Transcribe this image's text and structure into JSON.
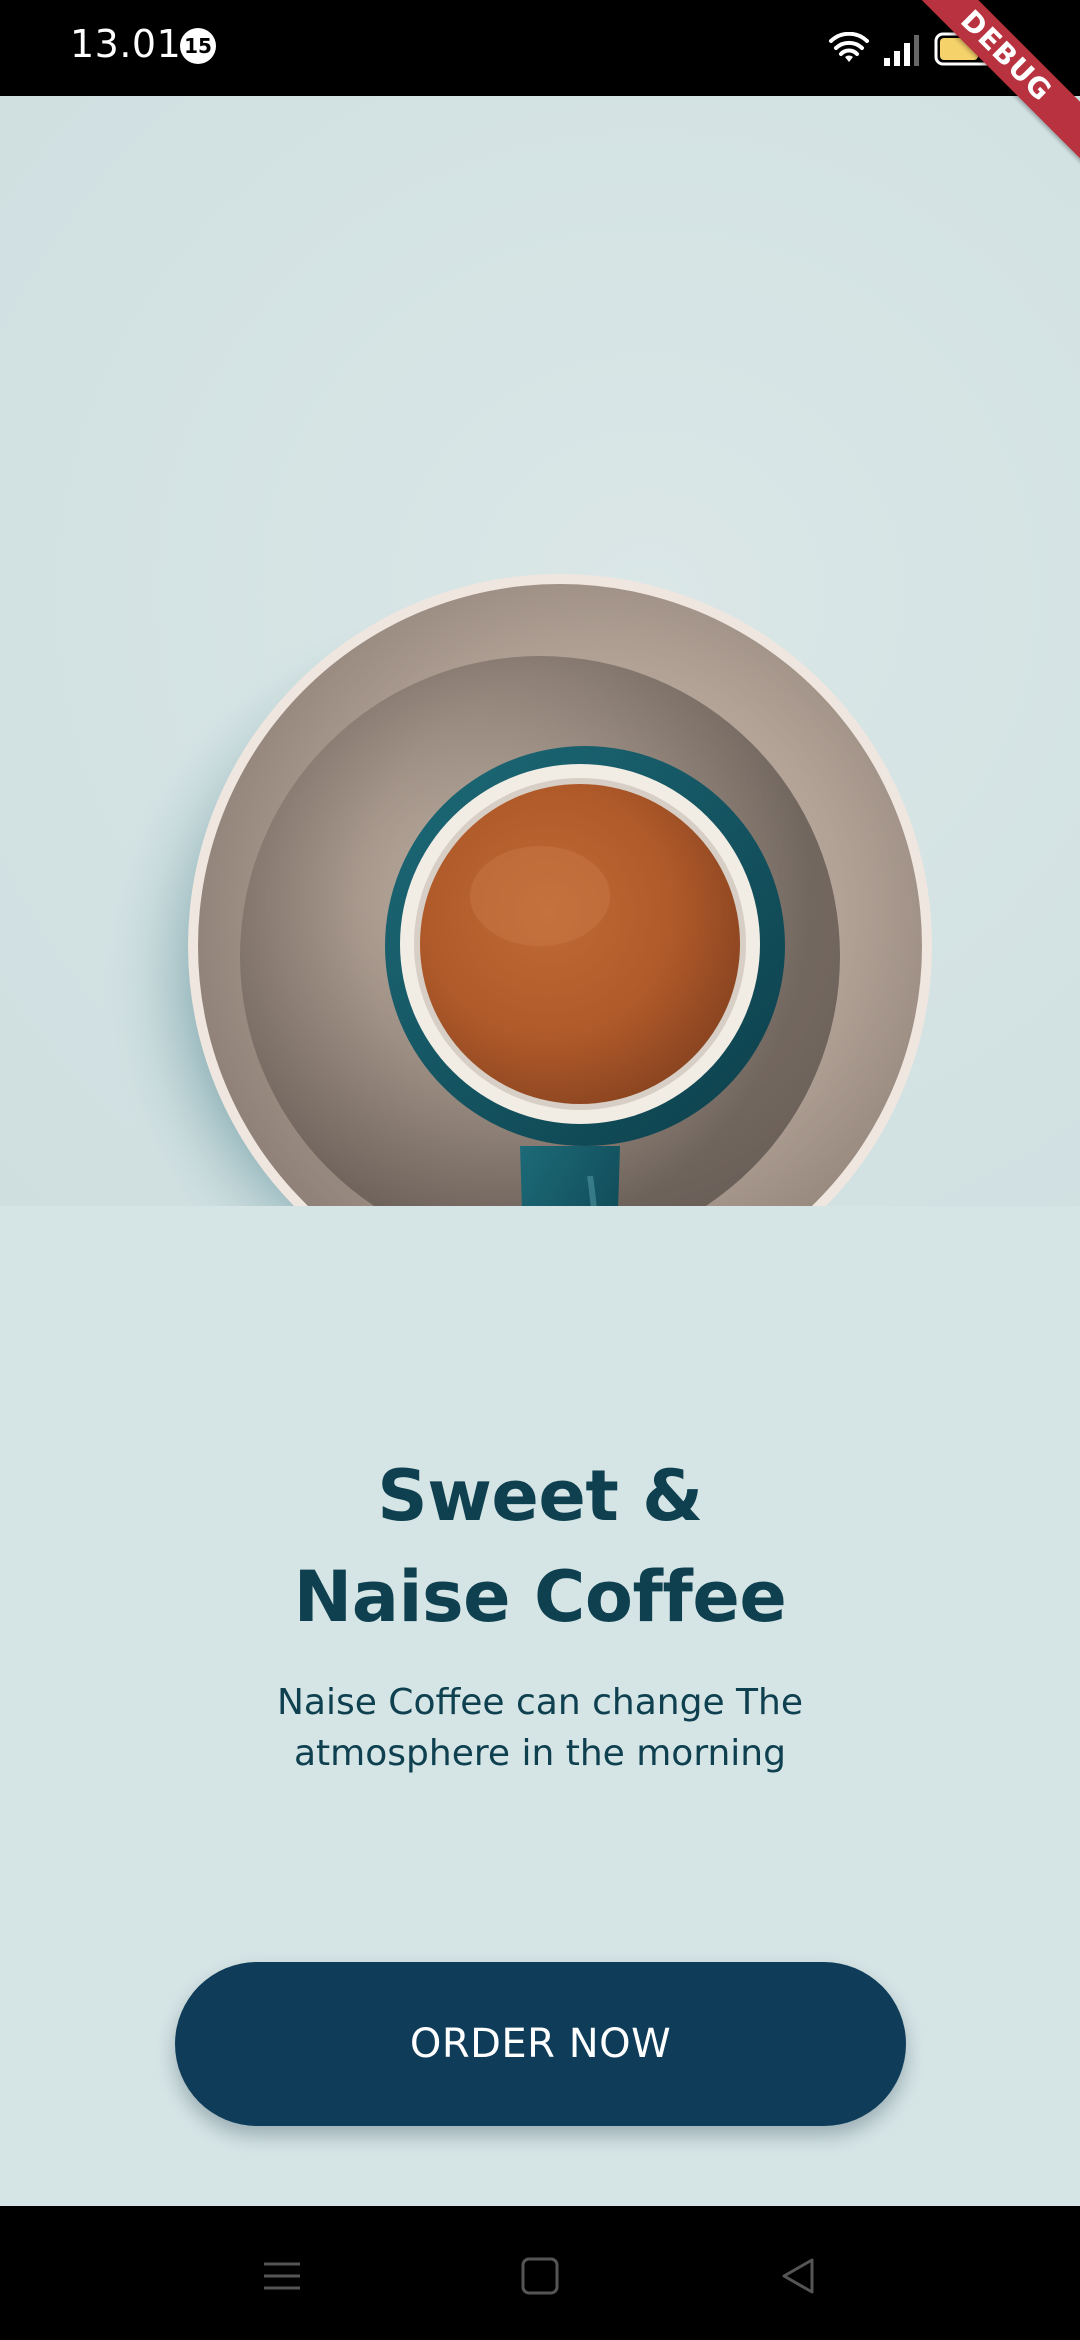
{
  "status_bar": {
    "time": "13.01",
    "notification_count": "15"
  },
  "debug_banner": {
    "label": "DEBUG"
  },
  "hero": {
    "image": "coffee-cup-on-saucer-illustration"
  },
  "content": {
    "title_line1": "Sweet &",
    "title_line2": "Naise Coffee",
    "subtitle_line1": "Naise Coffee can change The",
    "subtitle_line2": "atmosphere in the morning"
  },
  "cta": {
    "label": "ORDER NOW"
  },
  "navigation": {
    "items": [
      "menu-icon",
      "home-icon",
      "back-icon"
    ]
  },
  "colors": {
    "background": "#d5e4e5",
    "primary": "#0f3d59",
    "text": "#0e4050",
    "debug": "#b8323f"
  }
}
